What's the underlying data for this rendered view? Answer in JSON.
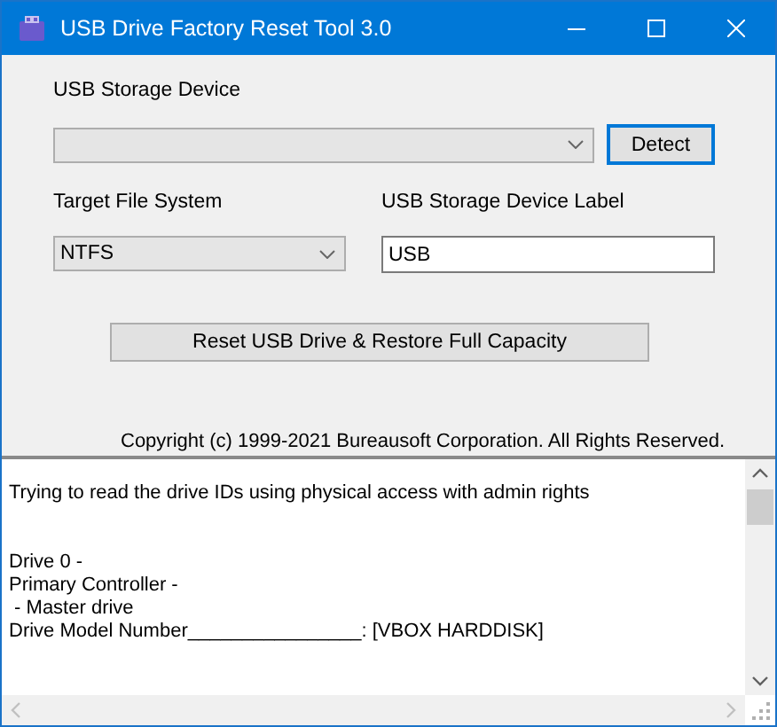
{
  "window": {
    "title": "USB Drive Factory Reset Tool 3.0"
  },
  "device": {
    "label": "USB Storage Device",
    "detect_button": "Detect"
  },
  "file_system": {
    "label": "Target File System",
    "value": "NTFS"
  },
  "volume_label": {
    "label": "USB Storage Device Label",
    "value": "USB"
  },
  "reset_button": "Reset USB Drive & Restore Full Capacity",
  "copyright": "Copyright (c) 1999-2021 Bureausoft Corporation. All Rights Reserved.",
  "log": {
    "blocks": [
      {
        "lines": [
          "Trying to read the drive IDs using physical access with admin rights"
        ]
      },
      {
        "lines": [
          "Drive 0 -",
          "Primary Controller -",
          " - Master drive",
          "Drive Model Number________________: [VBOX HARDDISK]"
        ]
      }
    ]
  }
}
